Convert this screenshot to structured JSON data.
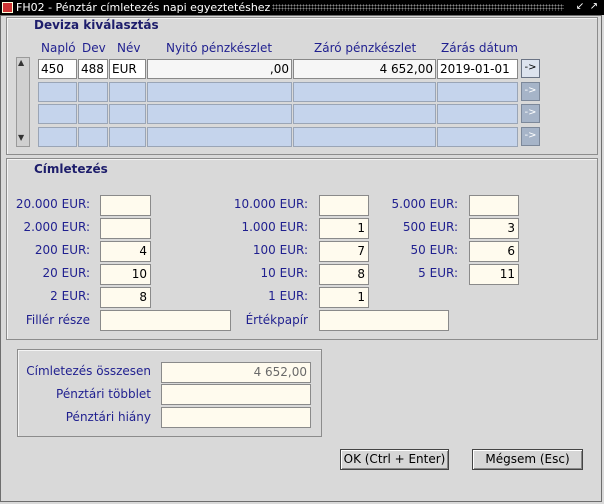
{
  "window": {
    "title": "FH02 - Pénztár címletezés napi egyeztetéshez"
  },
  "deviza": {
    "title": "Deviza kiválasztás",
    "headers": {
      "naplo": "Napló",
      "dev": "Dev",
      "nev": "Név",
      "nyito": "Nyitó pénzkészlet",
      "zaro": "Záró pénzkészlet",
      "datum": "Zárás dátum"
    },
    "rows": [
      {
        "naplo": "450",
        "dev": "488",
        "nev": "EUR",
        "nyito": ",00",
        "zaro": "4 652,00",
        "datum": "2019-01-01"
      }
    ],
    "arrow_label": "->"
  },
  "cimletezes": {
    "title": "Címletezés",
    "denominations": {
      "d20000": {
        "label": "20.000 EUR:",
        "value": ""
      },
      "d10000": {
        "label": "10.000 EUR:",
        "value": ""
      },
      "d5000": {
        "label": "5.000 EUR:",
        "value": ""
      },
      "d2000": {
        "label": "2.000 EUR:",
        "value": ""
      },
      "d1000": {
        "label": "1.000 EUR:",
        "value": "1"
      },
      "d500": {
        "label": "500 EUR:",
        "value": "3"
      },
      "d200": {
        "label": "200 EUR:",
        "value": "4"
      },
      "d100": {
        "label": "100 EUR:",
        "value": "7"
      },
      "d50": {
        "label": "50 EUR:",
        "value": "6"
      },
      "d20": {
        "label": "20 EUR:",
        "value": "10"
      },
      "d10": {
        "label": "10 EUR:",
        "value": "8"
      },
      "d5": {
        "label": "5 EUR:",
        "value": "11"
      },
      "d2": {
        "label": "2 EUR:",
        "value": "8"
      },
      "d1": {
        "label": "1 EUR:",
        "value": "1"
      }
    },
    "filler": {
      "label": "Fillér része",
      "value": ""
    },
    "ertekpapir": {
      "label": "Értékpapír",
      "value": ""
    }
  },
  "summary": {
    "osszesen": {
      "label": "Címletezés összesen",
      "value": "4 652,00"
    },
    "tobblet": {
      "label": "Pénztári többlet",
      "value": ""
    },
    "hiany": {
      "label": "Pénztári hiány",
      "value": ""
    }
  },
  "buttons": {
    "ok": "OK (Ctrl + Enter)",
    "cancel": "Mégsem (Esc)"
  }
}
